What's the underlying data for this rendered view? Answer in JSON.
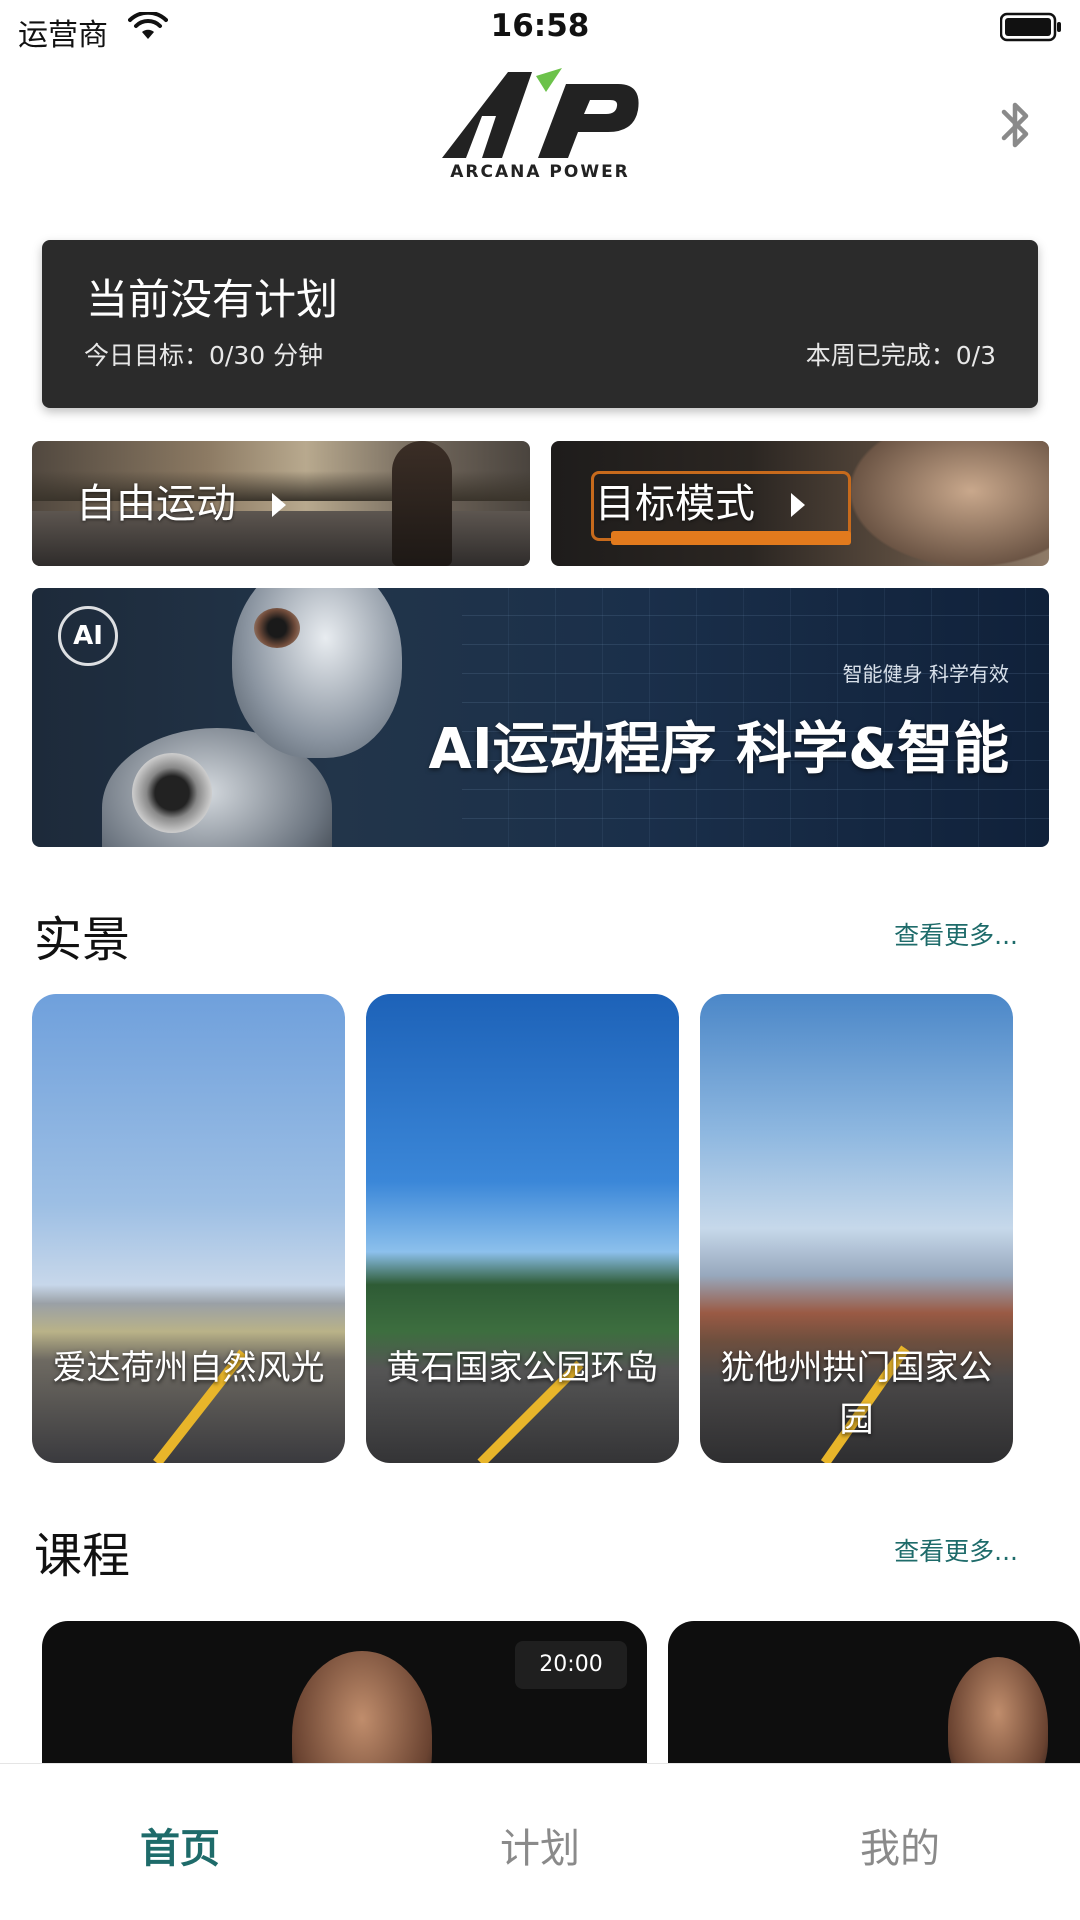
{
  "status_bar": {
    "carrier": "运营商",
    "time": "16:58"
  },
  "header": {
    "logo_text": "ARCANA POWER"
  },
  "plan_card": {
    "title": "当前没有计划",
    "today_goal": "今日目标：0/30 分钟",
    "week_done": "本周已完成：0/3"
  },
  "modes": [
    {
      "label": "自由运动"
    },
    {
      "label": "目标模式"
    }
  ],
  "ai_banner": {
    "badge": "AI",
    "subtitle": "智能健身 科学有效",
    "title": "AI运动程序 科学&智能"
  },
  "scenery": {
    "title": "实景",
    "more": "查看更多...",
    "items": [
      {
        "label": "爱达荷州自然风光"
      },
      {
        "label": "黄石国家公园环岛"
      },
      {
        "label": "犹他州拱门国家公园"
      }
    ]
  },
  "courses": {
    "title": "课程",
    "more": "查看更多...",
    "items": [
      {
        "duration": "20:00"
      },
      {
        "duration": ""
      }
    ]
  },
  "tabs": {
    "home": "首页",
    "plan": "计划",
    "mine": "我的",
    "active_color": "#1e6b6a",
    "inactive_color": "#8a8a8a"
  },
  "colors": {
    "accent": "#1e6b6a",
    "logo_green": "#6cc24a",
    "plan_card_bg": "#2b2b2b"
  }
}
